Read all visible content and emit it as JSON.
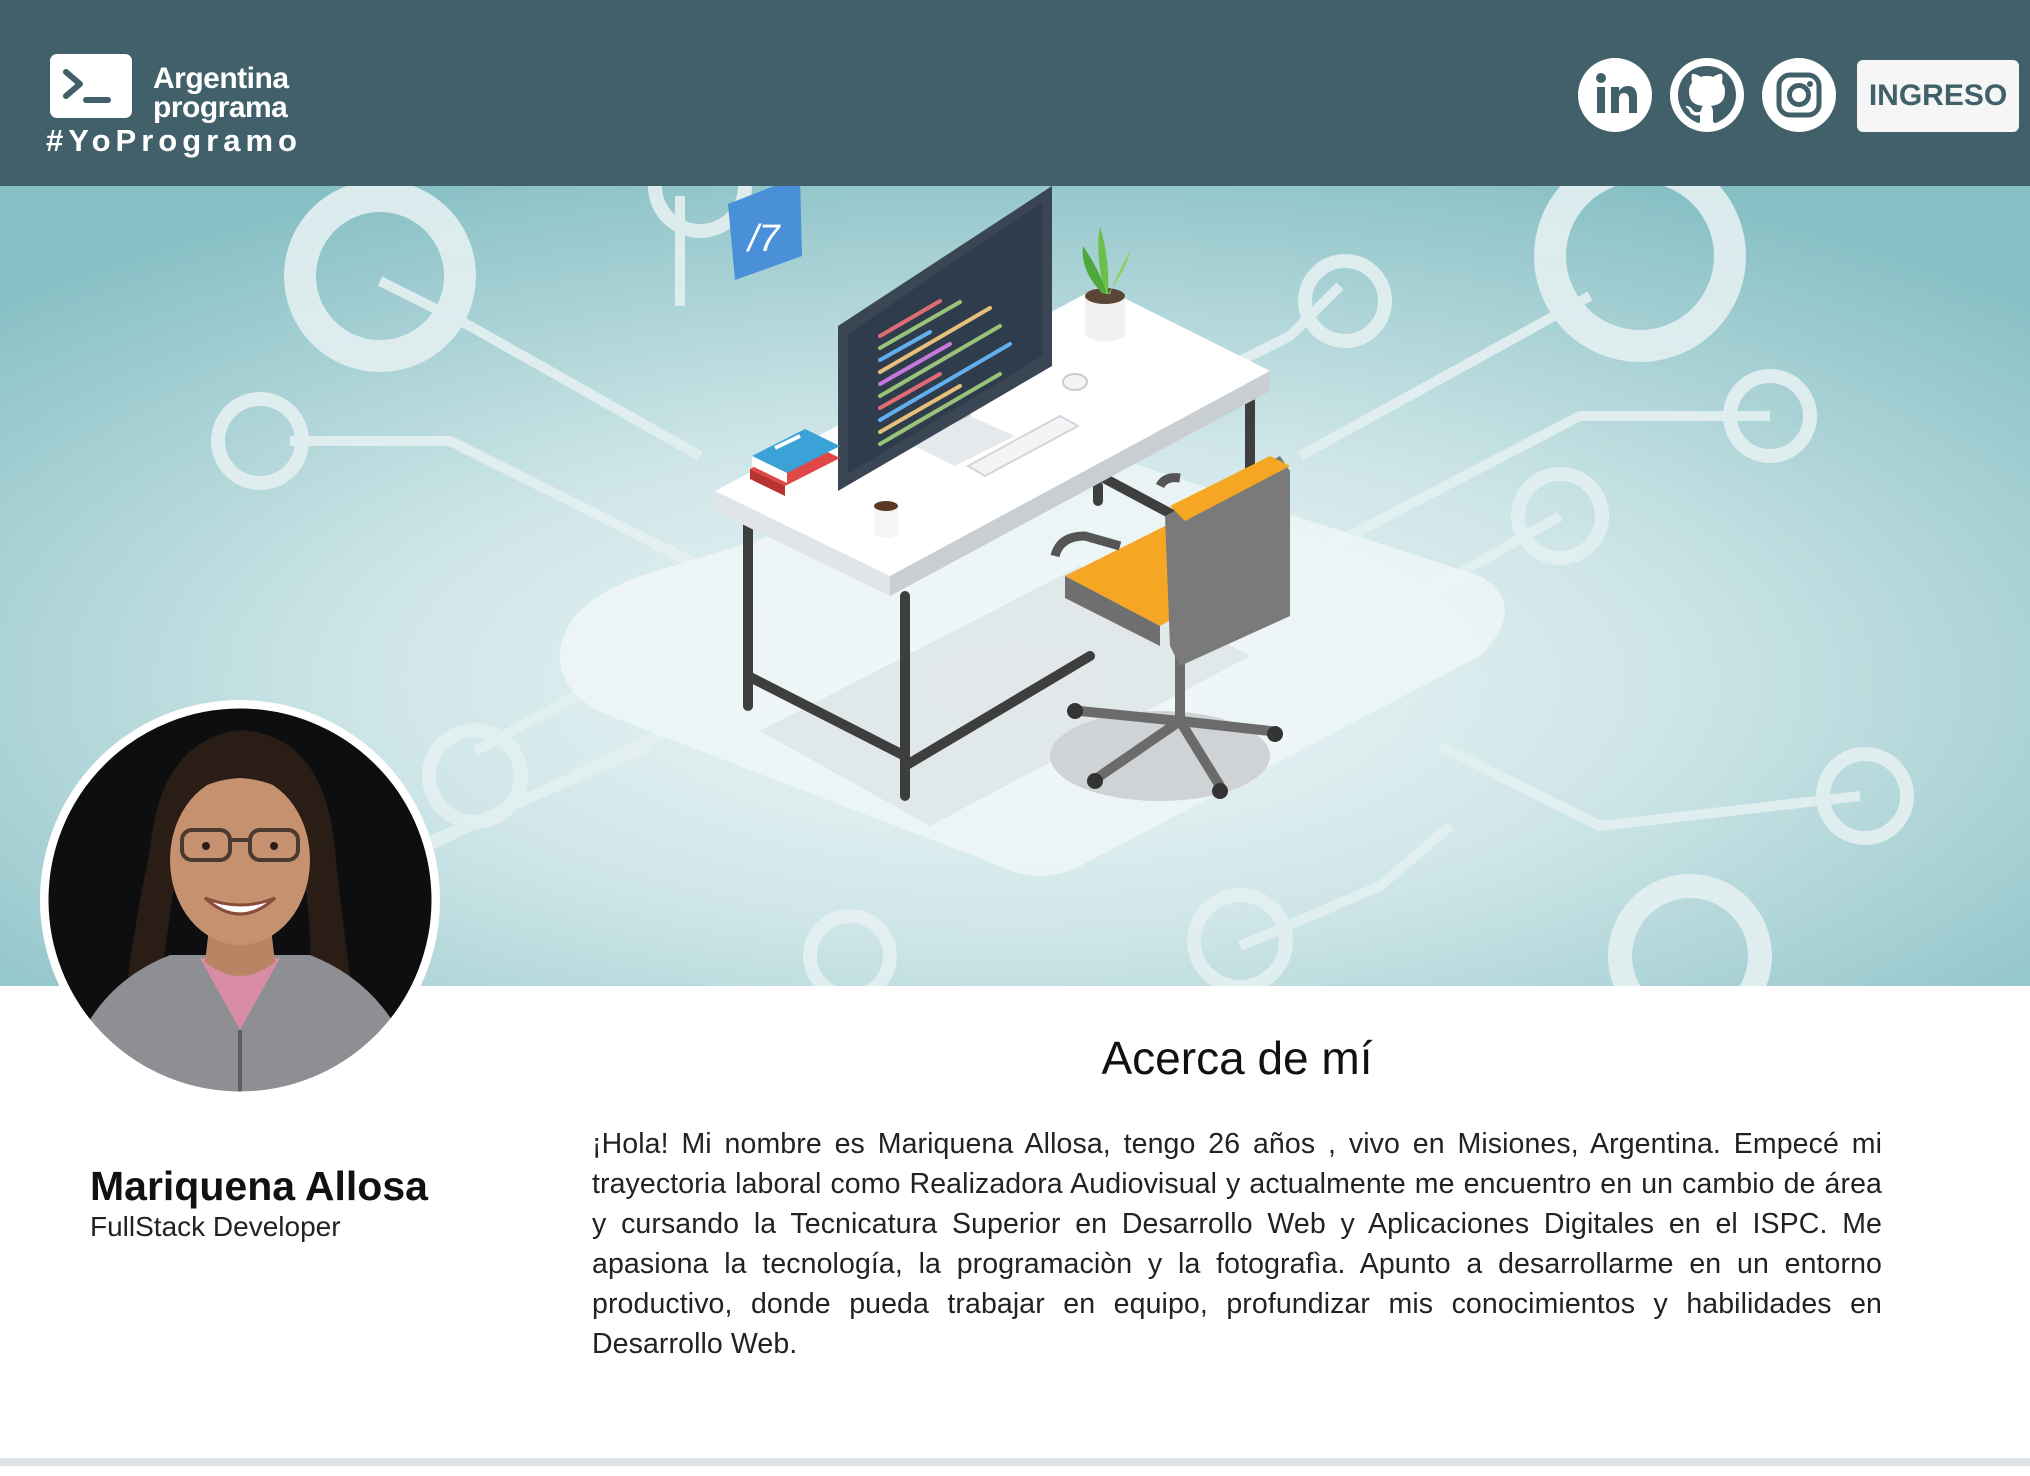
{
  "header": {
    "brand_line1": "Argentina",
    "brand_line2": "programa",
    "brand_tag": "#YoProgramo",
    "logo_icon": "terminal-prompt-icon",
    "social": [
      {
        "name": "LinkedIn",
        "icon": "linkedin-icon"
      },
      {
        "name": "GitHub",
        "icon": "github-icon"
      },
      {
        "name": "Instagram",
        "icon": "instagram-icon"
      }
    ],
    "login_label": "INGRESO"
  },
  "colors": {
    "header_bg": "#416069",
    "banner_light": "#eef6f7",
    "banner_dark": "#8ec2c7",
    "chair_seat": "#f5a623",
    "white": "#ffffff"
  },
  "banner": {
    "illustration": "isometric desk with computer monitor, plant, books, mug, keyboard, mouse and office chair over circuit-line background",
    "badge_text": "/7"
  },
  "profile": {
    "name": "Mariquena Allosa",
    "role": "FullStack Developer"
  },
  "about": {
    "title": "Acerca de mí",
    "text": "¡Hola! Mi nombre es Mariquena Allosa, tengo 26 años , vivo en Misiones, Argentina. Empecé mi trayectoria laboral como Realizadora Audiovisual y actualmente me encuentro en un cambio de área y cursando la Tecnicatura Superior en Desarrollo Web y Aplicaciones Digitales en el ISPC. Me apasiona la tecnología, la programaciòn y la fotografìa. Apunto a desarrollarme en un entorno productivo, donde pueda trabajar en equipo, profundizar mis conocimientos y habilidades en Desarrollo Web."
  }
}
